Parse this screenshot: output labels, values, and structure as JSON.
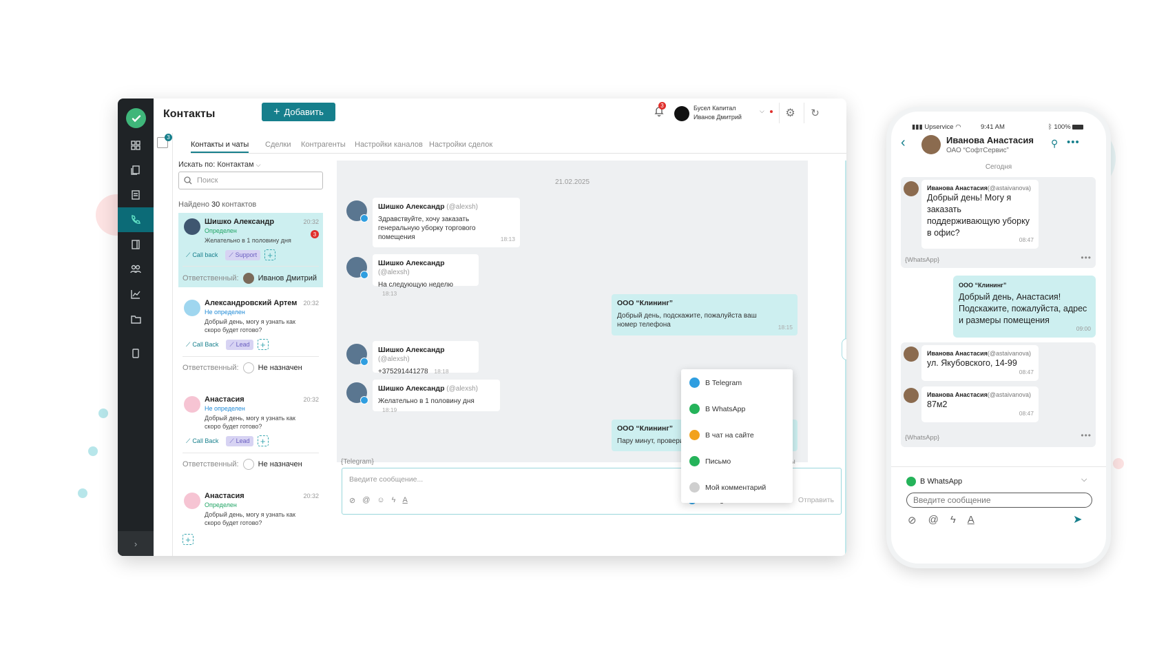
{
  "colors": {
    "accent": "#167f8c",
    "highlight": "#cdeff0",
    "danger": "#e0302c",
    "telegram": "#2f9ee0",
    "whatsapp": "#25b35a",
    "site_chat": "#f2a21c"
  },
  "app": {
    "title": "Контакты",
    "add_label": "Добавить",
    "notif_count": "3",
    "strip_badge": "3",
    "account_line1": "Бусел Капитал",
    "account_line2": "Иванов Дмитрий"
  },
  "tabs": [
    "Контакты и чаты",
    "Сделки",
    "Контрагенты",
    "Настройки каналов",
    "Настройки сделок"
  ],
  "list": {
    "search_by": "Искать по: Контактам",
    "search_placeholder": "Поиск",
    "found_prefix": "Найдено ",
    "found_count": "30",
    "found_suffix": " контактов",
    "responsible_label": "Ответственный:",
    "contacts": [
      {
        "name": "Шишко Александр",
        "time": "20:32",
        "status": "Определен",
        "message": "Желательно в 1 половину дня",
        "unread": "3",
        "tag1": "Call back",
        "tag2": "Support",
        "responsible": "Иванов Дмитрий"
      },
      {
        "name": "Александровский Артем",
        "time": "20:32",
        "status": "Не определен",
        "message": "Добрый день, могу я узнать как скоро будет готово?",
        "tag1": "Call Back",
        "tag2": "Lead",
        "responsible": "Не назначен"
      },
      {
        "name": "Анастасия",
        "time": "20:32",
        "status": "Не определен",
        "message": "Добрый день, могу я узнать как скоро будет готово?",
        "tag1": "Call Back",
        "tag2": "Lead",
        "responsible": "Не назначен"
      },
      {
        "name": "Анастасия",
        "time": "20:32",
        "status": "Определен",
        "message": "Добрый день, могу я узнать как скоро будет готово?"
      }
    ]
  },
  "chat": {
    "date": "21.02.2025",
    "messages": [
      {
        "sender": "Шишко Александр",
        "username": "(@alexsh)",
        "text": "Здравствуйте, хочу заказать генеральную уборку торгового помещения",
        "time": "18:13"
      },
      {
        "sender": "Шишко Александр",
        "username": "(@alexsh)",
        "text": "На следующую неделю",
        "time": "18:13"
      },
      {
        "sender": "ООО “Клининг”",
        "text": "Добрый день, подскажите, пожалуйста ваш номер телефона",
        "time": "18:15"
      },
      {
        "sender": "Шишко Александр",
        "username": "(@alexsh)",
        "text": "+375291441278",
        "time": "18:18"
      },
      {
        "sender": "Шишко Александр",
        "username": "(@alexsh)",
        "text": "Желательно в 1 половину дня",
        "time": "18:19"
      },
      {
        "sender": "ООО “Клининг”",
        "text": "Пару минут, провери"
      }
    ],
    "partial_right": "5",
    "partial_right2": "ты",
    "channel_tag": "{Telegram}",
    "input_placeholder": "Введите сообщение...",
    "channel_selected": "В Telegram",
    "send_label": "Отправить",
    "dropdown": [
      "В Telegram",
      "В WhatsApp",
      "В чат на сайте",
      "Письмо",
      "Мой комментарий"
    ]
  },
  "phone": {
    "carrier": "Upservice",
    "time": "9:41 AM",
    "battery": "100%",
    "contact_name": "Иванова Анастасия",
    "contact_org": "ОАО “СофтСервис”",
    "today": "Сегодня",
    "in_name": "Иванова Анастасия",
    "in_handle": "(@astaivanova)",
    "msg1": "Добрый день! Могу я заказать поддерживающую уборку в офис?",
    "msg1_time": "08:47",
    "tag": "{WhatsApp}",
    "out_sender": "ООО “Клининг”",
    "out_text": "Добрый день, Анастасия! Подскажите, пожалуйста, адрес и размеры помещения",
    "out_time": "09:00",
    "msg2": "ул. Якубовского, 14-99",
    "msg2_time": "08:47",
    "msg3": "87м2",
    "msg3_time": "08:47",
    "channel": "В WhatsApp",
    "input_placeholder": "Введите сообщение"
  }
}
